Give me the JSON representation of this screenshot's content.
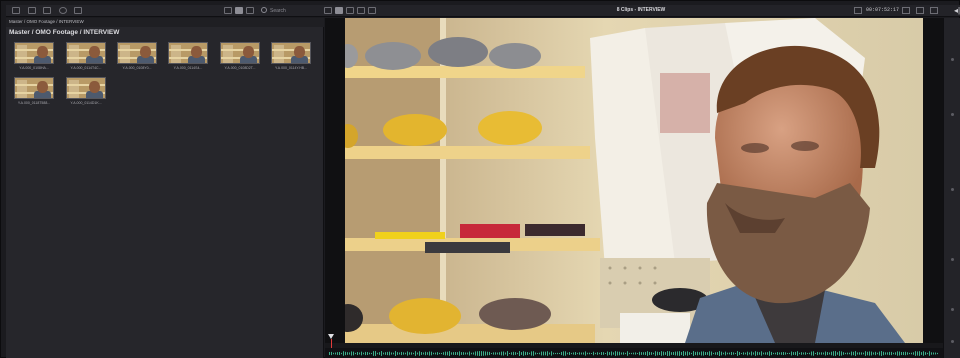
{
  "toolbar": {
    "search_placeholder": "Search",
    "viewer_title": "8 Clips - INTERVIEW",
    "timecode": "00:07:52:17"
  },
  "media_pool": {
    "breadcrumb_small": "Master / OMO Footage / INTERVIEW",
    "breadcrumb": "Master / OMO Footage / INTERVIEW",
    "clips": [
      {
        "label": "Y.A.000_0108HA..."
      },
      {
        "label": "Y.A.000_0114T4C..."
      },
      {
        "label": "Y.A.000_0108Y0..."
      },
      {
        "label": "Y.A.000_0114S4..."
      },
      {
        "label": "Y.A.000_0108D2T..."
      },
      {
        "label": "Y.A.000_0114Y.HB..."
      },
      {
        "label": "Y.A.000_0118T588..."
      },
      {
        "label": "Y.A.000_0114D1K..."
      }
    ]
  },
  "icons": [
    "search-icon",
    "list-view-icon",
    "thumbnail-view-icon",
    "sort-icon",
    "metadata-icon",
    "options-icon"
  ],
  "colors": {
    "accent": "#e23b3b",
    "waveform": "#3bb08a"
  }
}
